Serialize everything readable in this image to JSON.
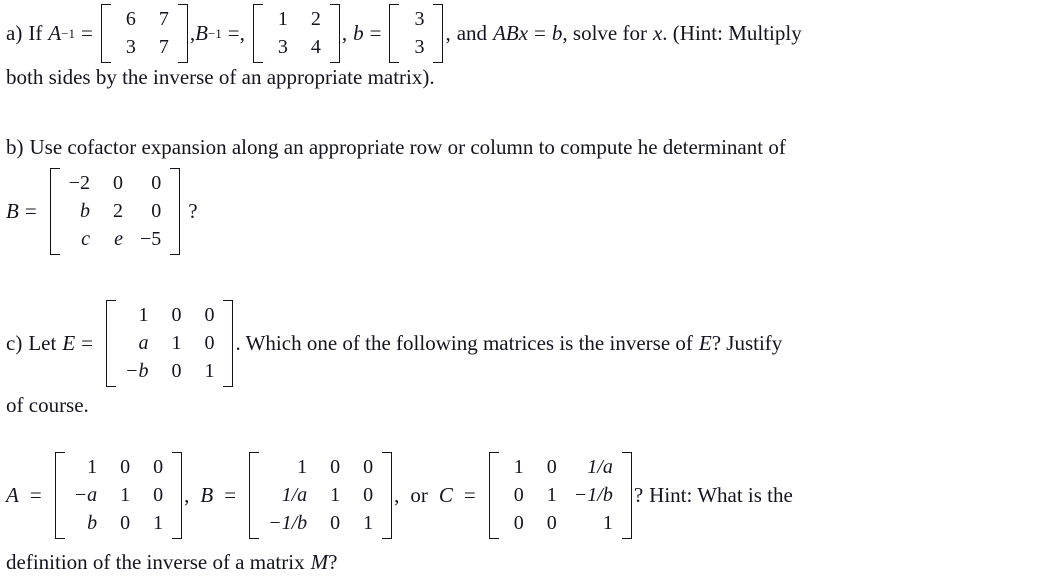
{
  "document": {
    "problems": [
      {
        "id": "a",
        "label": "a)",
        "lead": "If",
        "sym_A_inv": "A",
        "sym_A_exp": "−1",
        "eq1": "=",
        "comma1": ",",
        "sym_B_inv": "B",
        "sym_B_exp": "−1",
        "eq2": "=,",
        "comma2": ",",
        "sym_b": "b",
        "eq3": "=",
        "comma3": ",",
        "tail": "and",
        "expr_ABx": "ABx",
        "eq4": "=",
        "expr_b": "b",
        "tail2": ", solve for",
        "var_x": "x",
        "tail3": ". (Hint: Multiply",
        "continuation": "both sides by the inverse of an appropriate matrix).",
        "matrix_A_inv": {
          "rows": [
            [
              "6",
              "7"
            ],
            [
              "3",
              "7"
            ]
          ]
        },
        "matrix_B_inv": {
          "rows": [
            [
              "1",
              "2"
            ],
            [
              "3",
              "4"
            ]
          ]
        },
        "vector_b": {
          "rows": [
            [
              "3"
            ],
            [
              "3"
            ]
          ]
        }
      },
      {
        "id": "b",
        "label": "b)",
        "text": "Use cofactor expansion along an appropriate row or column to compute he determinant of",
        "sym_B": "B",
        "eq": "=",
        "question_mark": "?",
        "matrix_B": {
          "rows": [
            [
              "−2",
              "0",
              "0"
            ],
            [
              "b",
              "2",
              "0"
            ],
            [
              "c",
              "e",
              "−5"
            ]
          ]
        }
      },
      {
        "id": "c",
        "label": "c)",
        "lead": "Let",
        "sym_E": "E",
        "eq": "=",
        "tail": ". Which one of the following matrices is the inverse of",
        "sym_E2": "E",
        "tail2": "? Justify",
        "continuation": "of course.",
        "matrix_E": {
          "rows": [
            [
              "1",
              "0",
              "0"
            ],
            [
              "a",
              "1",
              "0"
            ],
            [
              "−b",
              "0",
              "1"
            ]
          ]
        }
      },
      {
        "id": "d",
        "sym_A": "A",
        "eq_A": "=",
        "comma_A": ",",
        "sym_B": "B",
        "eq_B": "=",
        "comma_B": ",",
        "or_text": "or",
        "sym_C": "C",
        "eq_C": "=",
        "question_mark": "?",
        "hint": "Hint: What is the",
        "continuation": "definition of the inverse of a matrix",
        "sym_M": "M",
        "continuation_end": "?",
        "matrix_A": {
          "rows": [
            [
              "1",
              "0",
              "0"
            ],
            [
              "−a",
              "1",
              "0"
            ],
            [
              "b",
              "0",
              "1"
            ]
          ]
        },
        "matrix_B": {
          "rows": [
            [
              "1",
              "0",
              "0"
            ],
            [
              "1/a",
              "1",
              "0"
            ],
            [
              "−1/b",
              "0",
              "1"
            ]
          ]
        },
        "matrix_C": {
          "rows": [
            [
              "1",
              "0",
              "1/a"
            ],
            [
              "0",
              "1",
              "−1/b"
            ],
            [
              "0",
              "0",
              "1"
            ]
          ]
        }
      }
    ],
    "colors": {
      "text": "#141420",
      "background": "#ffffff"
    }
  }
}
